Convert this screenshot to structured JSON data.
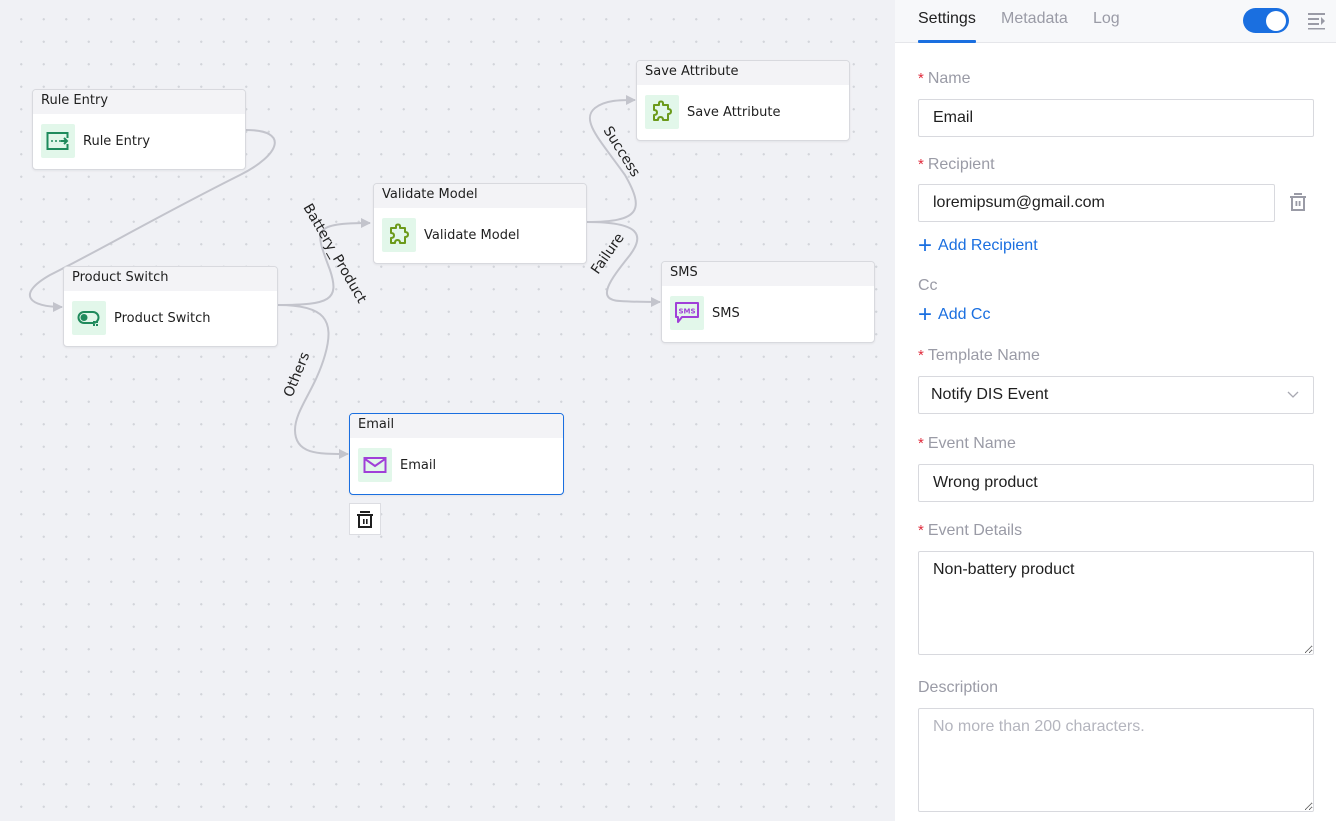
{
  "canvas": {
    "nodes": [
      {
        "id": "rule-entry",
        "header": "Rule Entry",
        "label": "Rule Entry",
        "icon": "entry-arrow-icon",
        "icon_color": "#1f8a5c"
      },
      {
        "id": "product-switch",
        "header": "Product Switch",
        "label": "Product Switch",
        "icon": "switch-toggle-icon",
        "icon_color": "#1f8a5c"
      },
      {
        "id": "validate-model",
        "header": "Validate Model",
        "label": "Validate Model",
        "icon": "puzzle-icon",
        "icon_color": "#6b9a1a"
      },
      {
        "id": "save-attribute",
        "header": "Save Attribute",
        "label": "Save Attribute",
        "icon": "puzzle-icon",
        "icon_color": "#6b9a1a"
      },
      {
        "id": "sms",
        "header": "SMS",
        "label": "SMS",
        "icon": "sms-bubble-icon",
        "icon_color": "#a040d8",
        "icon_text": "SMS"
      },
      {
        "id": "email",
        "header": "Email",
        "label": "Email",
        "icon": "envelope-icon",
        "icon_color": "#a040d8",
        "selected": true
      }
    ],
    "edges": [
      {
        "from": "rule-entry",
        "to": "product-switch",
        "label": ""
      },
      {
        "from": "product-switch",
        "to": "validate-model",
        "label": "Battery_Product"
      },
      {
        "from": "product-switch",
        "to": "email",
        "label": "Others"
      },
      {
        "from": "validate-model",
        "to": "save-attribute",
        "label": "Success"
      },
      {
        "from": "validate-model",
        "to": "sms",
        "label": "Failure"
      }
    ],
    "node_delete_icon": "trash-icon"
  },
  "panel": {
    "tabs": [
      {
        "label": "Settings",
        "active": true
      },
      {
        "label": "Metadata",
        "active": false
      },
      {
        "label": "Log",
        "active": false
      }
    ],
    "enabled_toggle": true,
    "accent_color": "#1a6fe0",
    "required_marker": "*",
    "fields": {
      "name": {
        "label": "Name",
        "required": true,
        "value": "Email"
      },
      "recipient": {
        "label": "Recipient",
        "required": true,
        "value": "loremipsum@gmail.com"
      },
      "add_recipient": "Add Recipient",
      "cc": {
        "label": "Cc",
        "required": false
      },
      "add_cc": "Add Cc",
      "template_name": {
        "label": "Template Name",
        "required": true,
        "value": "Notify DIS Event"
      },
      "event_name": {
        "label": "Event Name",
        "required": true,
        "value": "Wrong product"
      },
      "event_details": {
        "label": "Event Details",
        "required": true,
        "value": "Non-battery product"
      },
      "description": {
        "label": "Description",
        "required": false,
        "value": "",
        "placeholder": "No more than 200 characters."
      }
    }
  }
}
